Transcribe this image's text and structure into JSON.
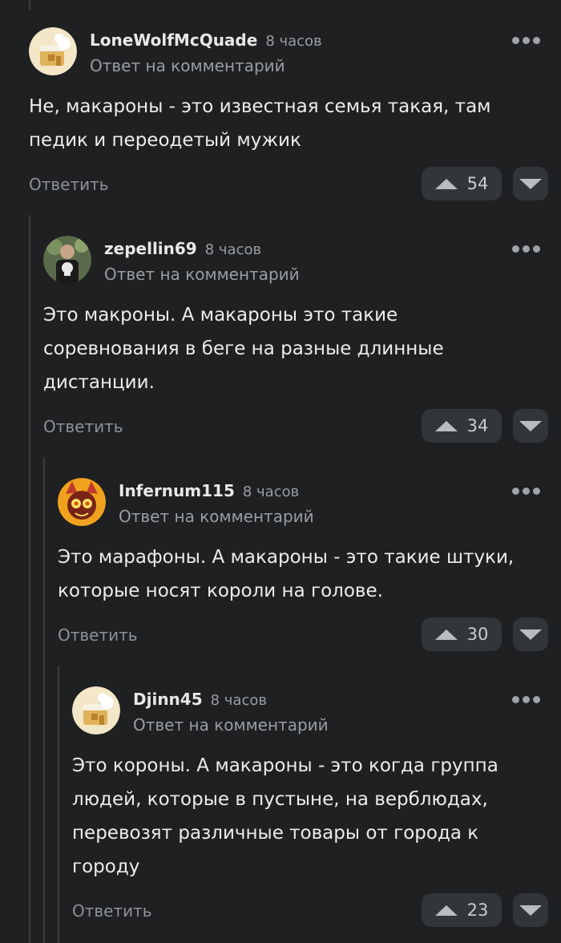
{
  "reply_to_label": "Ответ на комментарий",
  "reply_button_label": "Ответить",
  "comments": [
    {
      "author": "LoneWolfMcQuade",
      "time": "8 часов",
      "text": "Не, макароны - это известная семья такая, там\nпедик и переодетый мужик",
      "votes": "54",
      "avatar": "baked-house-avatar"
    },
    {
      "author": "zepellin69",
      "time": "8 часов",
      "text": "Это макроны. А макароны это такие\nсоревнования в беге на разные длинные\nдистанции.",
      "votes": "34",
      "avatar": "skull-shirt-photo-avatar"
    },
    {
      "author": "Infernum115",
      "time": "8 часов",
      "text": "Это марафоны. А макароны - это такие штуки,\nкоторые носят короли на голове.",
      "votes": "30",
      "avatar": "fire-creature-avatar"
    },
    {
      "author": "Djinn45",
      "time": "8 часов",
      "text": "Это короны. А макароны - это когда группа\nлюдей, которые в пустыне, на верблюдах,\nперевозят различные товары от города к\nгороду",
      "votes": "23",
      "avatar": "baked-house-avatar"
    }
  ],
  "colors": {
    "background": "#1e2022",
    "thread_line": "#3a3d41",
    "vote_button": "#32363a",
    "muted_text": "#9a9ea3"
  }
}
